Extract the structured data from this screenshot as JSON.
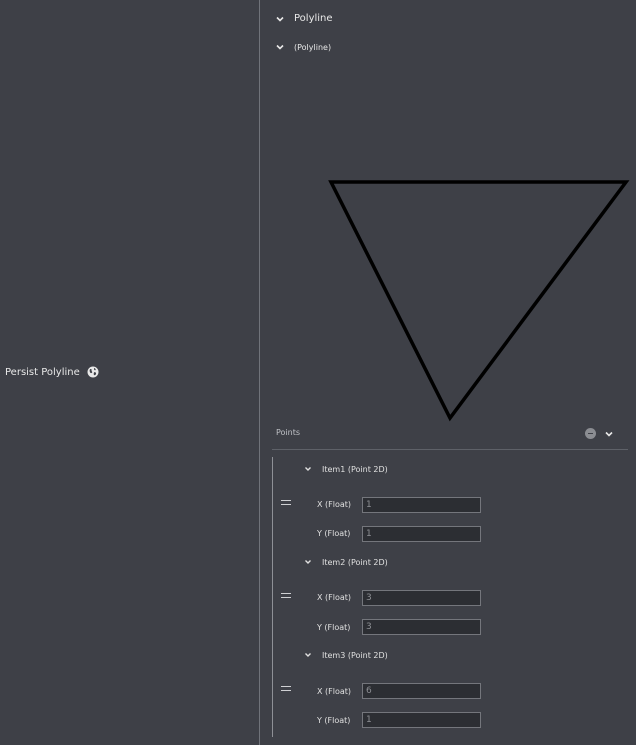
{
  "node": {
    "label": "Persist Polyline",
    "icon": "globe-icon"
  },
  "panel": {
    "title": "Polyline",
    "subtitle": "(Polyline)"
  },
  "points": {
    "label": "Points",
    "items": [
      {
        "header": "Item1 (Point 2D)",
        "x_label": "X (Float)",
        "x_value": "1",
        "y_label": "Y (Float)",
        "y_value": "1"
      },
      {
        "header": "Item2 (Point 2D)",
        "x_label": "X (Float)",
        "x_value": "3",
        "y_label": "Y (Float)",
        "y_value": "3"
      },
      {
        "header": "Item3 (Point 2D)",
        "x_label": "X (Float)",
        "x_value": "6",
        "y_label": "Y (Float)",
        "y_value": "1"
      }
    ]
  },
  "colors": {
    "background": "#3e4047",
    "input_bg": "#2c2e33",
    "stroke": "#000000"
  }
}
